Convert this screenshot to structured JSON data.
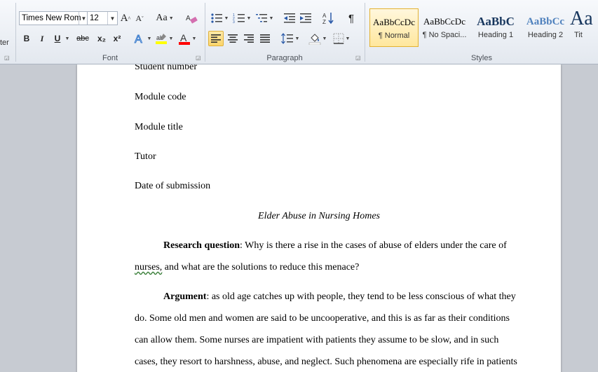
{
  "ribbon": {
    "clipboard_partial_label": "ter",
    "font": {
      "name": "Times New Rom",
      "size": "12",
      "group_label": "Font",
      "grow_glyph": "A",
      "shrink_glyph": "A",
      "case_glyph": "Aa",
      "bold": "B",
      "italic": "I",
      "underline": "U",
      "strike": "abc",
      "subscript": "x₂",
      "superscript": "x²",
      "highlight_glyph": "ab",
      "color_glyph": "A"
    },
    "paragraph": {
      "group_label": "Paragraph",
      "pilcrow": "¶"
    },
    "styles": {
      "group_label": "Styles",
      "tiles": [
        {
          "preview": "AaBbCcDc",
          "name": "¶ Normal"
        },
        {
          "preview": "AaBbCcDc",
          "name": "¶ No Spaci..."
        },
        {
          "preview": "AaBbC",
          "name": "Heading 1"
        },
        {
          "preview": "AaBbCc",
          "name": "Heading 2"
        },
        {
          "preview": "Aa",
          "name": "Tit"
        }
      ]
    },
    "colors": {
      "heading_blue": "#17365d",
      "heading2_blue": "#4f81bd",
      "highlight_yellow": "#ffff00",
      "font_red": "#ff0000"
    }
  },
  "document": {
    "student_number": "Student number",
    "module_code": "Module code",
    "module_title": "Module title",
    "tutor": "Tutor",
    "date": "Date of submission",
    "title": "Elder Abuse in Nursing Homes",
    "rq_label": "Research question",
    "rq_text_1": ": Why is there a rise in the cases of abuse of elders under the care of",
    "rq_word": "nurses,",
    "rq_text_2": " and what are the solutions to reduce this menace?",
    "arg_label": "Argument",
    "arg_line_1": ": as old age catches up with people, they tend to be less conscious of what they",
    "arg_line_2": "do. Some old men and women are said to be uncooperative, and this is as far as their conditions",
    "arg_line_3": "can allow them. Some nurses are impatient with patients they assume to be slow, and in such",
    "arg_line_4": "cases, they resort to harshness, abuse, and neglect. Such phenomena are especially rife in patients"
  }
}
